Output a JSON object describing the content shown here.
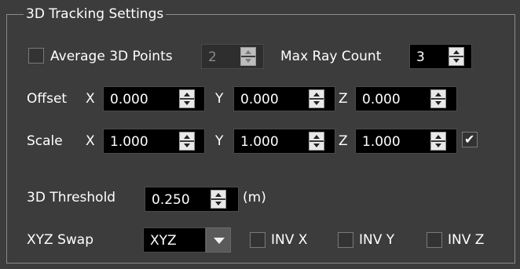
{
  "group": {
    "title": "3D Tracking Settings"
  },
  "row1": {
    "average_label": "Average 3D Points",
    "average_checked": false,
    "average_value": "2",
    "max_ray_label": "Max Ray Count",
    "max_ray_value": "3"
  },
  "offset": {
    "label": "Offset",
    "x_label": "X",
    "y_label": "Y",
    "z_label": "Z",
    "x": "0.000",
    "y": "0.000",
    "z": "0.000"
  },
  "scale": {
    "label": "Scale",
    "x_label": "X",
    "y_label": "Y",
    "z_label": "Z",
    "x": "1.000",
    "y": "1.000",
    "z": "1.000",
    "uniform_checked": true
  },
  "threshold": {
    "label": "3D Threshold",
    "value": "0.250",
    "unit": "(m)"
  },
  "swap": {
    "label": "XYZ Swap",
    "selected": "XYZ",
    "inv_x_label": "INV X",
    "inv_x_checked": false,
    "inv_y_label": "INV Y",
    "inv_y_checked": false,
    "inv_z_label": "INV Z",
    "inv_z_checked": false
  }
}
